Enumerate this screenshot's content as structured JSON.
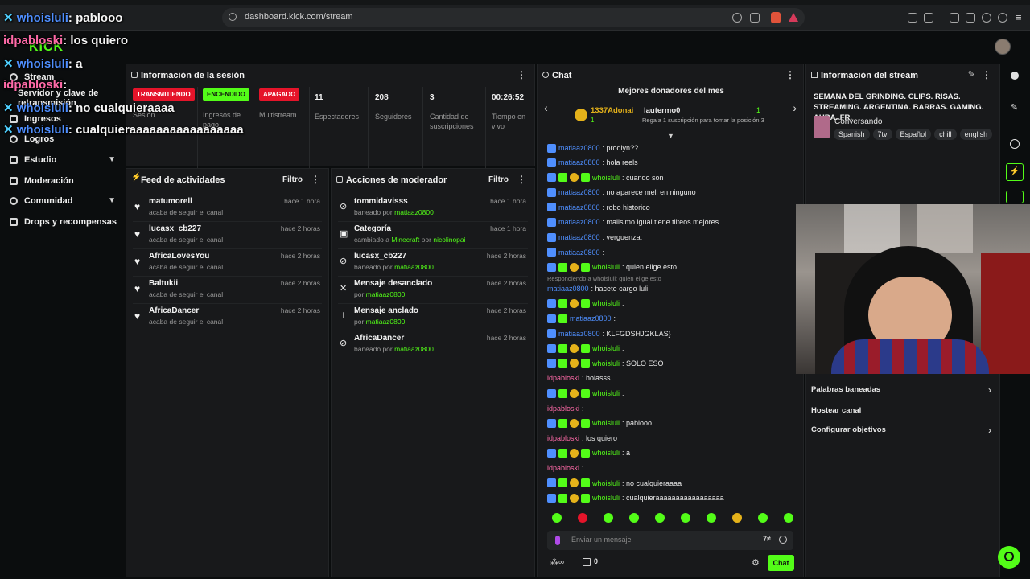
{
  "browser": {
    "url": "dashboard.kick.com/stream"
  },
  "sidebar": {
    "logo": "KICK",
    "items": [
      {
        "label": "Stream"
      },
      {
        "label": "Servidor y clave de retransmisión"
      },
      {
        "label": "Ingresos"
      },
      {
        "label": "Logros"
      },
      {
        "label": "Estudio"
      },
      {
        "label": "Moderación"
      },
      {
        "label": "Comunidad"
      },
      {
        "label": "Drops y recompensas"
      }
    ]
  },
  "overlay_chat": [
    {
      "user": "idpabloski",
      "text": "los quiero"
    },
    {
      "user": "whoisluli",
      "text": "pablooo"
    },
    {
      "user": "whoisluli",
      "text": "a"
    },
    {
      "user": "idpabloski",
      "text": ""
    },
    {
      "user": "whoisluli",
      "text": "no cualquieraaaa"
    },
    {
      "user": "whoisluli",
      "text": "cualquieraaaaaaaaaaaaaaaaa"
    }
  ],
  "session": {
    "title": "Información de la sesión",
    "stats": [
      {
        "badge": "TRANSMITIENDO",
        "label": "Sesión"
      },
      {
        "badge": "ENCENDIDO",
        "label": "Ingresos de pago"
      },
      {
        "badge": "APAGADO",
        "label": "Multistream"
      },
      {
        "value": "11",
        "label": "Espectadores"
      },
      {
        "value": "208",
        "label": "Seguidores"
      },
      {
        "value": "3",
        "label": "Cantidad de suscripciones"
      },
      {
        "value": "00:26:52",
        "label": "Tiempo en vivo"
      }
    ]
  },
  "feed": {
    "title": "Feed de actividades",
    "filter": "Filtro",
    "rows": [
      {
        "name": "matumorell",
        "sub": "acaba de seguir el canal",
        "time": "hace 1 hora"
      },
      {
        "name": "lucasx_cb227",
        "sub": "acaba de seguir el canal",
        "time": "hace 2 horas"
      },
      {
        "name": "AfricaLovesYou",
        "sub": "acaba de seguir el canal",
        "time": "hace 2 horas"
      },
      {
        "name": "Baltukii",
        "sub": "acaba de seguir el canal",
        "time": "hace 2 horas"
      },
      {
        "name": "AfricaDancer",
        "sub": "acaba de seguir el canal",
        "time": "hace 2 horas"
      }
    ]
  },
  "mod": {
    "title": "Acciones de moderador",
    "filter": "Filtro",
    "rows": [
      {
        "name": "tommidavisss",
        "pre": "baneado por",
        "by": "matiaaz0800",
        "time": "hace 1 hora"
      },
      {
        "name": "Categoría",
        "pre": "cambiado a",
        "by": "Minecraft",
        "mid": "por",
        "by2": "nicolinopai",
        "time": "hace 1 hora"
      },
      {
        "name": "lucasx_cb227",
        "pre": "baneado por",
        "by": "matiaaz0800",
        "time": "hace 2 horas"
      },
      {
        "name": "Mensaje desanclado",
        "pre": "por",
        "by": "matiaaz0800",
        "time": "hace 2 horas"
      },
      {
        "name": "Mensaje anclado",
        "pre": "por",
        "by": "matiaaz0800",
        "time": "hace 2 horas"
      },
      {
        "name": "AfricaDancer",
        "pre": "baneado por",
        "by": "matiaaz0800",
        "time": "hace 2 horas"
      }
    ]
  },
  "chat": {
    "title": "Chat",
    "donors_title": "Mejores donadores del mes",
    "donor1": {
      "name": "1337Adonai",
      "count": "1"
    },
    "donor2": {
      "name": "lautermo0",
      "count": "1",
      "note": "Regala 1 suscripción para tomar la posición 3"
    },
    "messages": [
      {
        "user": "matiaaz0800",
        "text": ": prodlyn??",
        "color": "blue",
        "badges": 1
      },
      {
        "user": "matiaaz0800",
        "text": ": hola reels",
        "color": "blue",
        "badges": 1
      },
      {
        "user": "whoisluli",
        "text": ": cuando son",
        "color": "green",
        "badges": 4
      },
      {
        "user": "matiaaz0800",
        "text": ": no aparece meli en ninguno",
        "color": "blue",
        "badges": 1
      },
      {
        "user": "matiaaz0800",
        "text": ": robo historico",
        "color": "blue",
        "badges": 1
      },
      {
        "user": "matiaaz0800",
        "text": ": malisimo igual tiene tilteos mejores",
        "color": "blue",
        "badges": 1
      },
      {
        "user": "matiaaz0800",
        "text": ": verguenza.",
        "color": "blue",
        "badges": 1
      },
      {
        "user": "matiaaz0800",
        "text": ":",
        "color": "blue",
        "badges": 1
      },
      {
        "user": "whoisluli",
        "text": ": quien elige esto",
        "color": "green",
        "badges": 4
      },
      {
        "user": "matiaaz0800",
        "text": ": hacete cargo luli",
        "color": "blue",
        "badges": 0,
        "reply": "Respondiendo a whoisluli: quien elige esto"
      },
      {
        "user": "whoisluli",
        "text": ":",
        "color": "green",
        "badges": 4
      },
      {
        "user": "matiaaz0800",
        "text": ":",
        "color": "blue",
        "badges": 2
      },
      {
        "user": "matiaaz0800",
        "text": ": KLFGDSHJGKLAS}",
        "color": "blue",
        "badges": 1
      },
      {
        "user": "whoisluli",
        "text": ":",
        "color": "green",
        "badges": 4
      },
      {
        "user": "whoisluli",
        "text": ": SOLO ESO",
        "color": "green",
        "badges": 4
      },
      {
        "user": "idpabloski",
        "text": ": holasss",
        "color": "pink",
        "badges": 0
      },
      {
        "user": "whoisluli",
        "text": ":",
        "color": "green",
        "badges": 4
      },
      {
        "user": "idpabloski",
        "text": ":",
        "color": "pink",
        "badges": 0
      },
      {
        "user": "whoisluli",
        "text": ": pablooo",
        "color": "green",
        "badges": 4
      },
      {
        "user": "idpabloski",
        "text": ": los quiero",
        "color": "pink",
        "badges": 0
      },
      {
        "user": "whoisluli",
        "text": ": a",
        "color": "green",
        "badges": 4
      },
      {
        "user": "idpabloski",
        "text": ":",
        "color": "pink",
        "badges": 0
      },
      {
        "user": "whoisluli",
        "text": ": no cualquieraaaa",
        "color": "green",
        "badges": 4
      },
      {
        "user": "whoisluli",
        "text": ": cualquieraaaaaaaaaaaaaaaaa",
        "color": "green",
        "badges": 4
      }
    ],
    "input_placeholder": "Enviar un mensaje",
    "points": "0",
    "send_label": "Chat"
  },
  "stream_info": {
    "title": "Información del stream",
    "stream_title": "SEMANA DEL GRINDING. CLIPS. RISAS. STREAMING. ARGENTINA. BARRAS. GAMING. AURA. FR.",
    "category": "Conversando",
    "tags": [
      "Spanish",
      "7tv",
      "Español",
      "chill",
      "english"
    ],
    "links": [
      {
        "label": "Palabras baneadas"
      },
      {
        "label": "Hostear canal"
      },
      {
        "label": "Configurar objetivos"
      }
    ]
  },
  "colors": {
    "accent": "#53fc18",
    "live_red": "#e5142a",
    "panel": "#18191b",
    "username_blue": "#4f8fff",
    "username_pink": "#ff6aa8"
  }
}
